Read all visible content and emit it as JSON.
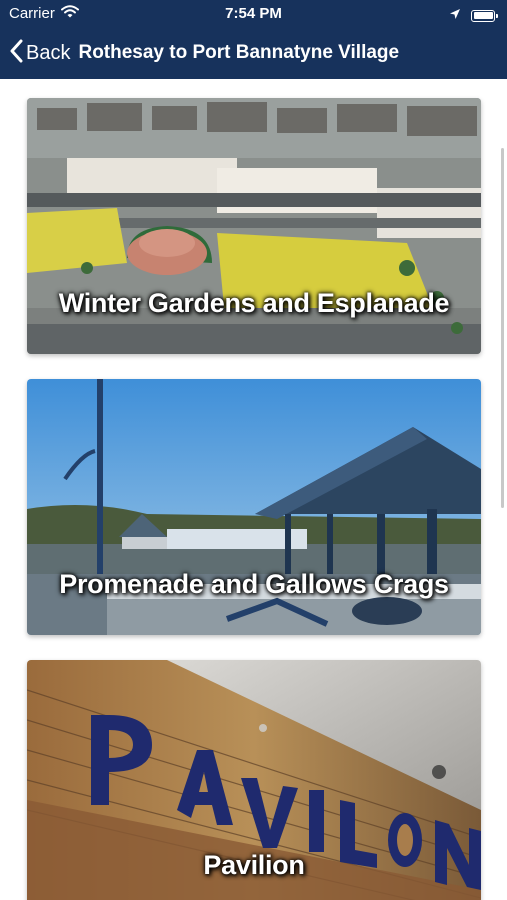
{
  "status_bar": {
    "carrier": "Carrier",
    "time": "7:54 PM",
    "icons": [
      "wifi-icon",
      "location-arrow-icon",
      "battery-icon"
    ]
  },
  "nav": {
    "back_label": "Back",
    "title": "Rothesay to Port Bannatyne Village",
    "background_color": "#17325c"
  },
  "cards": [
    {
      "title": "Winter Gardens and Esplanade"
    },
    {
      "title": "Promenade and Gallows Crags"
    },
    {
      "title": "Pavilion"
    }
  ]
}
